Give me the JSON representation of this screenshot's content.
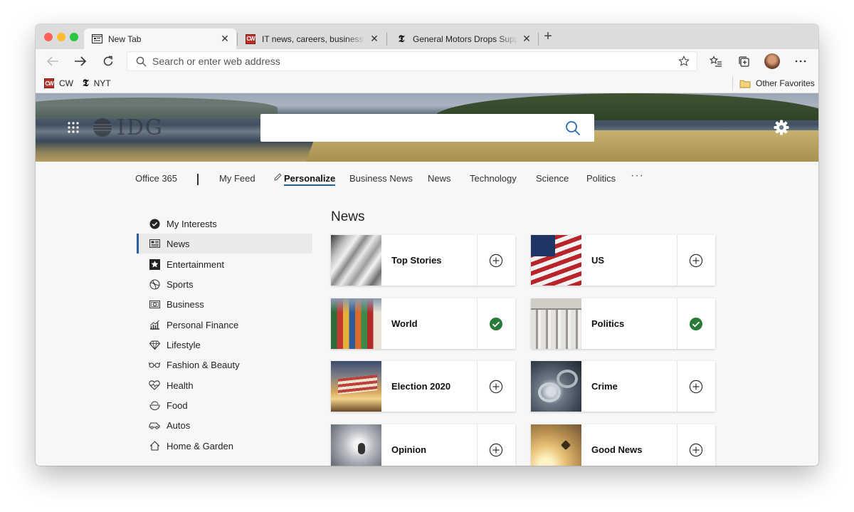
{
  "colors": {
    "accent": "#1f5f9c",
    "check": "#2a7a3a",
    "tab_active": "#f7f7f7"
  },
  "tabs": [
    {
      "title": "New Tab",
      "icon": "new-tab-page-icon"
    },
    {
      "title": "IT news, careers, business technology",
      "icon": "computerworld-favicon"
    },
    {
      "title": "General Motors Drops Support for",
      "icon": "nyt-favicon"
    }
  ],
  "toolbar": {
    "address_placeholder": "Search or enter web address"
  },
  "bookmarks": {
    "items": [
      {
        "label": "CW"
      },
      {
        "label": "NYT"
      }
    ],
    "other_favorites": "Other Favorites"
  },
  "hero": {
    "logo": "IDG",
    "search_value": ""
  },
  "nav": {
    "items": [
      "Office 365",
      "My Feed",
      "Personalize",
      "Business News",
      "News",
      "Technology",
      "Science",
      "Politics"
    ],
    "active": "Personalize",
    "more": "···"
  },
  "sidebar": {
    "items": [
      {
        "label": "My Interests",
        "icon": "check-circle-icon"
      },
      {
        "label": "News",
        "icon": "newspaper-icon"
      },
      {
        "label": "Entertainment",
        "icon": "star-icon"
      },
      {
        "label": "Sports",
        "icon": "sports-ball-icon"
      },
      {
        "label": "Business",
        "icon": "money-icon"
      },
      {
        "label": "Personal Finance",
        "icon": "chart-icon"
      },
      {
        "label": "Lifestyle",
        "icon": "diamond-icon"
      },
      {
        "label": "Fashion & Beauty",
        "icon": "glasses-icon"
      },
      {
        "label": "Health",
        "icon": "heartbeat-icon"
      },
      {
        "label": "Food",
        "icon": "food-icon"
      },
      {
        "label": "Autos",
        "icon": "car-icon"
      },
      {
        "label": "Home & Garden",
        "icon": "home-icon"
      }
    ],
    "active": "News"
  },
  "main": {
    "heading": "News",
    "cards": [
      {
        "label": "Top Stories",
        "followed": false
      },
      {
        "label": "US",
        "followed": false
      },
      {
        "label": "World",
        "followed": true
      },
      {
        "label": "Politics",
        "followed": true
      },
      {
        "label": "Election 2020",
        "followed": false
      },
      {
        "label": "Crime",
        "followed": false
      },
      {
        "label": "Opinion",
        "followed": false
      },
      {
        "label": "Good News",
        "followed": false
      }
    ]
  }
}
